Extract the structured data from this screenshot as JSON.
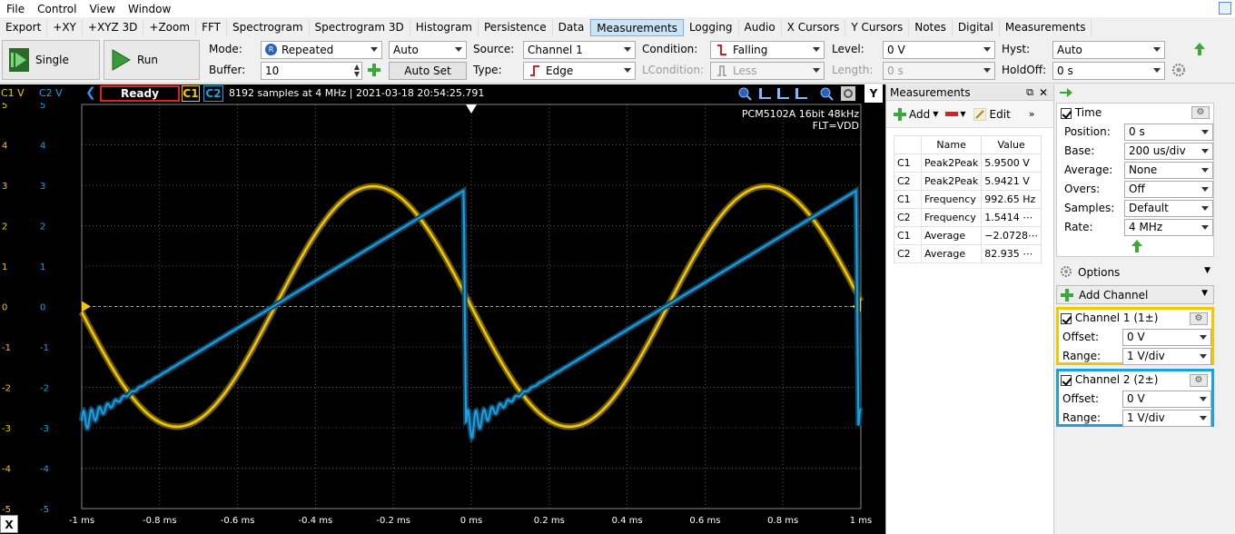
{
  "menu": [
    "File",
    "Control",
    "View",
    "Window"
  ],
  "tabs": [
    "Export",
    "+XY",
    "+XYZ 3D",
    "+Zoom",
    "FFT",
    "Spectrogram",
    "Spectrogram 3D",
    "Histogram",
    "Persistence",
    "Data",
    "Measurements",
    "Logging",
    "Audio",
    "X Cursors",
    "Y Cursors",
    "Notes",
    "Digital",
    "Measurements"
  ],
  "active_tab_index": 10,
  "controls": {
    "single_label": "Single",
    "run_label": "Run",
    "mode_label": "Mode:",
    "mode_value": "Repeated",
    "buffer_label": "Buffer:",
    "buffer_value": "10",
    "auto_value": "Auto",
    "autoset_label": "Auto Set",
    "source_label": "Source:",
    "source_value": "Channel 1",
    "type_label": "Type:",
    "type_value": "Edge",
    "condition_label": "Condition:",
    "condition_value": "Falling",
    "lcondition_label": "LCondition:",
    "lcondition_value": "Less",
    "level_label": "Level:",
    "level_value": "0 V",
    "length_label": "Length:",
    "length_value": "0 s",
    "hyst_label": "Hyst:",
    "hyst_value": "Auto",
    "holdoff_label": "HoldOff:",
    "holdoff_value": "0 s"
  },
  "scope": {
    "c1v_label": "C1 V",
    "c2v_label": "C2 V",
    "status": "Ready",
    "c1_tag": "C1",
    "c2_tag": "C2",
    "info": "8192 samples at 4 MHz | 2021-03-18 20:54:25.791",
    "device_line1": "PCM5102A 16bit 48kHz",
    "device_line2": "FLT=VDD",
    "y_ticks_c1": [
      "5",
      "4",
      "3",
      "2",
      "1",
      "0",
      "-1",
      "-2",
      "-3",
      "-4",
      "-5"
    ],
    "y_ticks_c2": [
      "5",
      "4",
      "3",
      "2",
      "1",
      "0",
      "-1",
      "-2",
      "-3",
      "-4",
      "-5"
    ],
    "x_ticks": [
      "-1 ms",
      "-0.8 ms",
      "-0.6 ms",
      "-0.4 ms",
      "-0.2 ms",
      "0 ms",
      "0.2 ms",
      "0.4 ms",
      "0.6 ms",
      "0.8 ms",
      "1 ms"
    ],
    "x_button": "X",
    "y_button": "Y",
    "colors": {
      "c1": "#f4c800",
      "c2": "#1ea0e0"
    }
  },
  "measurements": {
    "title": "Measurements",
    "add_label": "Add",
    "edit_label": "Edit",
    "col_name": "Name",
    "col_value": "Value",
    "rows": [
      {
        "ch": "C1",
        "name": "Peak2Peak",
        "value": "5.9500 V"
      },
      {
        "ch": "C2",
        "name": "Peak2Peak",
        "value": "5.9421 V"
      },
      {
        "ch": "C1",
        "name": "Frequency",
        "value": "992.65 Hz"
      },
      {
        "ch": "C2",
        "name": "Frequency",
        "value": "1.5414 ⋯"
      },
      {
        "ch": "C1",
        "name": "Average",
        "value": "−2.0728⋯"
      },
      {
        "ch": "C2",
        "name": "Average",
        "value": "82.935 ⋯"
      }
    ]
  },
  "timepanel": {
    "time_label": "Time",
    "position_label": "Position:",
    "position_value": "0 s",
    "base_label": "Base:",
    "base_value": "200 us/div",
    "average_label": "Average:",
    "average_value": "None",
    "overs_label": "Overs:",
    "overs_value": "Off",
    "samples_label": "Samples:",
    "samples_value": "Default",
    "rate_label": "Rate:",
    "rate_value": "4 MHz",
    "options_label": "Options",
    "add_channel_label": "Add Channel",
    "ch1_label": "Channel 1 (1±)",
    "ch2_label": "Channel 2 (2±)",
    "offset_label": "Offset:",
    "range_label": "Range:",
    "ch1_offset": "0 V",
    "ch1_range": "1 V/div",
    "ch2_offset": "0 V",
    "ch2_range": "1 V/div"
  }
}
